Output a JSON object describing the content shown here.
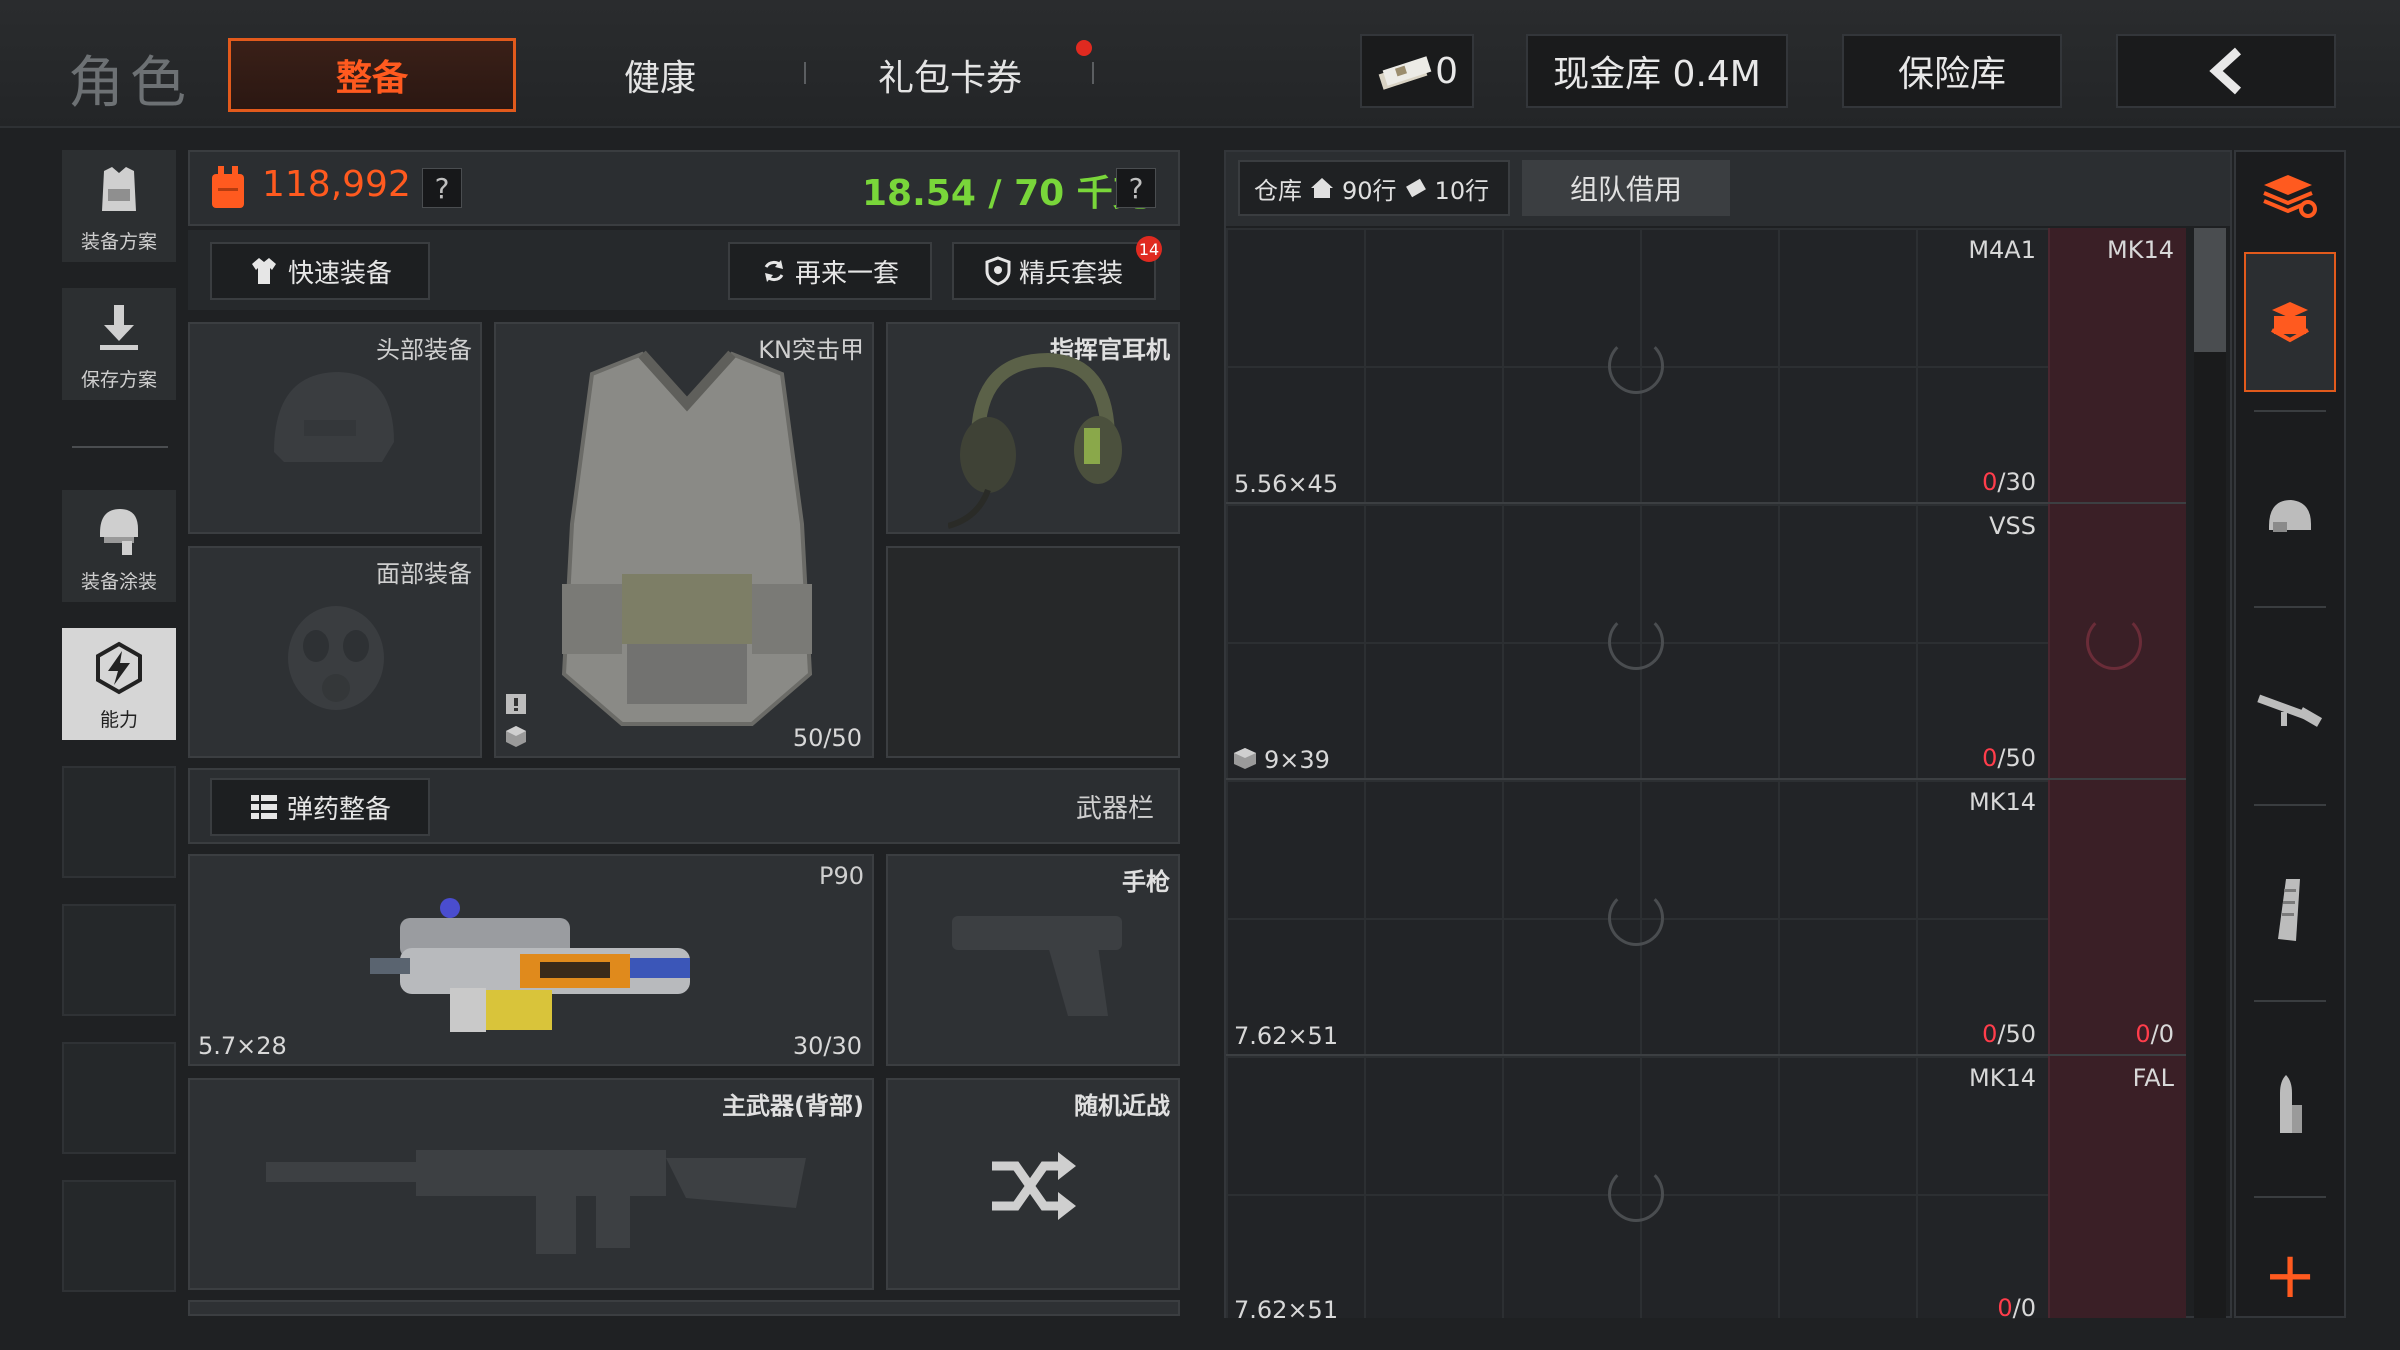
{
  "header": {
    "title": "角色",
    "tabs": [
      {
        "label": "整备",
        "active": true
      },
      {
        "label": "健康"
      },
      {
        "label": "礼包卡券",
        "has_notification": true
      }
    ],
    "currency_count": "0",
    "cash_vault": "现金库 0.4M",
    "safe_label": "保险库"
  },
  "sidebar": {
    "items": [
      {
        "label": "装备方案",
        "icon": "armor-plan-icon"
      },
      {
        "label": "保存方案",
        "icon": "save-download-icon"
      },
      {
        "label": "装备涂装",
        "icon": "helmet-paint-icon"
      },
      {
        "label": "能力",
        "icon": "ability-lightning-icon",
        "active": true
      }
    ]
  },
  "loadout": {
    "value": "118,992",
    "load": "18.54 / 70 千克",
    "help": "?",
    "buttons": {
      "quick_equip": "快速装备",
      "again": "再来一套",
      "elite": "精兵套装",
      "elite_badge": "14"
    },
    "slots": {
      "head": "头部装备",
      "face": "面部装备",
      "armor_name": "KN突击甲",
      "armor_durability": "50/50",
      "headset": "指挥官耳机"
    },
    "ammo_button": "弹药整备",
    "weapon_bar": "武器栏",
    "weapons": {
      "primary_name": "P90",
      "primary_caliber": "5.7×28",
      "primary_ammo": "30/30",
      "pistol": "手枪",
      "back_primary": "主武器(背部)",
      "melee": "随机近战"
    }
  },
  "storage": {
    "warehouse": "仓库",
    "house_rows": "90行",
    "ticket_rows": "10行",
    "team_borrow": "组队借用",
    "rows": [
      {
        "weapon": "M4A1",
        "weapon2": "MK14",
        "caliber": "5.56×45",
        "count_red": "0",
        "count_rest": "/30"
      },
      {
        "weapon": "VSS",
        "weapon2": "",
        "caliber": "9×39",
        "count_red": "0",
        "count_rest": "/50"
      },
      {
        "weapon": "MK14",
        "weapon2": "",
        "caliber": "7.62×51",
        "count_red": "0",
        "count_rest": "/50",
        "count2_red": "0",
        "count2_rest": "/0"
      },
      {
        "weapon": "MK14",
        "weapon2": "FAL",
        "caliber": "7.62×51",
        "count_red": "0",
        "count_rest": "/0"
      }
    ]
  },
  "filters": {
    "items": [
      "all-filter-icon",
      "backpack-filter-icon",
      "helmet-filter-icon",
      "rifle-filter-icon",
      "magazine-filter-icon",
      "ammo-filter-icon"
    ],
    "add": "+"
  },
  "colors": {
    "accent": "#e25a1c",
    "load_green": "#79d63a",
    "danger_red": "#ff3d4b"
  }
}
